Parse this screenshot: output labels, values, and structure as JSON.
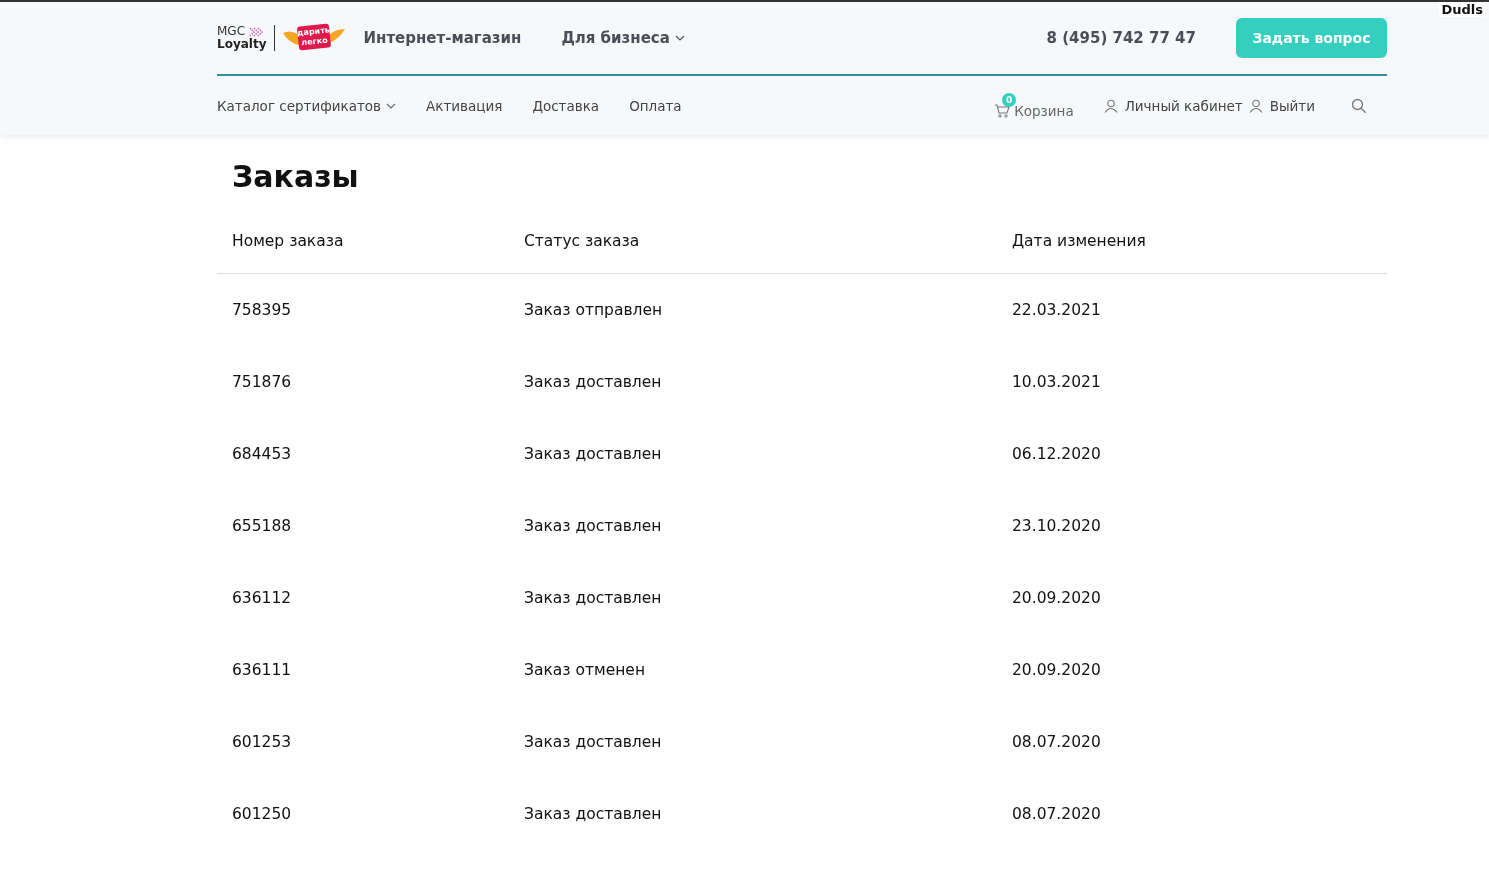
{
  "corner_label": "Dudls",
  "header": {
    "logo": {
      "brand_top": "MGC",
      "brand_bottom": "Loyalty",
      "badge_top": "дарить",
      "badge_bottom": "легко"
    },
    "top_links": [
      {
        "label": "Интернет-магазин",
        "dropdown": false
      },
      {
        "label": "Для бизнеса",
        "dropdown": true
      }
    ],
    "phone": "8 (495) 742 77 47",
    "ask_button": "Задать вопрос",
    "nav": [
      {
        "label": "Каталог сертификатов",
        "dropdown": true
      },
      {
        "label": "Активация",
        "dropdown": false
      },
      {
        "label": "Доставка",
        "dropdown": false
      },
      {
        "label": "Оплата",
        "dropdown": false
      }
    ],
    "cart": {
      "label": "Корзина",
      "count": "0"
    },
    "account": "Личный кабинет",
    "logout": "Выйти"
  },
  "page_title": "Заказы",
  "table": {
    "columns": [
      "Номер заказа",
      "Статус заказа",
      "Дата изменения"
    ],
    "rows": [
      [
        "758395",
        "Заказ отправлен",
        "22.03.2021"
      ],
      [
        "751876",
        "Заказ доставлен",
        "10.03.2021"
      ],
      [
        "684453",
        "Заказ доставлен",
        "06.12.2020"
      ],
      [
        "655188",
        "Заказ доставлен",
        "23.10.2020"
      ],
      [
        "636112",
        "Заказ доставлен",
        "20.09.2020"
      ],
      [
        "636111",
        "Заказ отменен",
        "20.09.2020"
      ],
      [
        "601253",
        "Заказ доставлен",
        "08.07.2020"
      ],
      [
        "601250",
        "Заказ доставлен",
        "08.07.2020"
      ]
    ]
  }
}
